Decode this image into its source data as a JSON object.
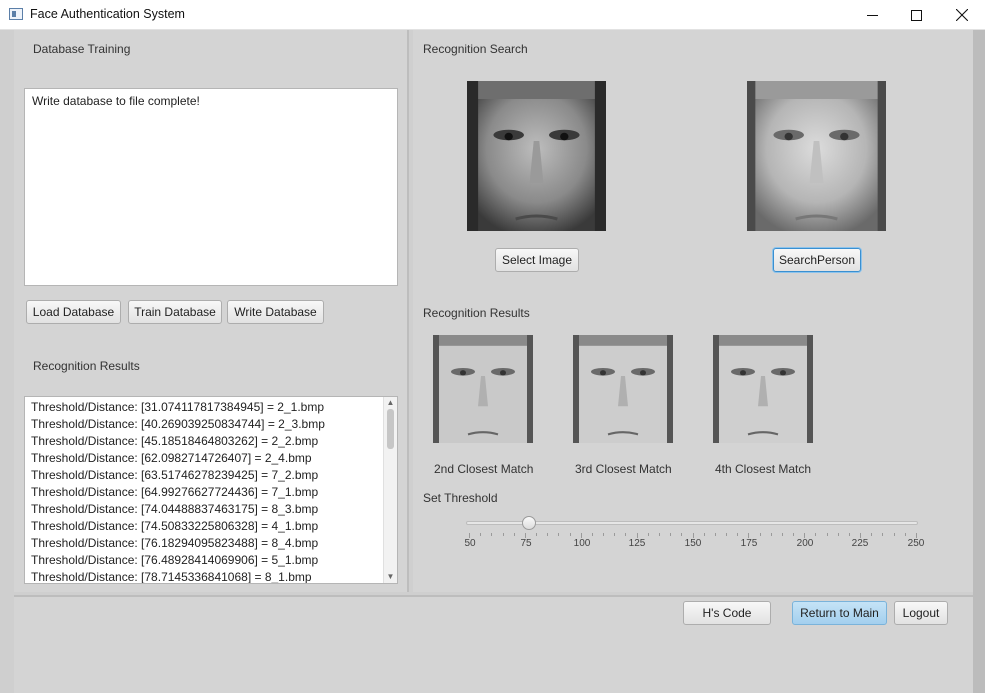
{
  "window": {
    "title": "Face Authentication System"
  },
  "training": {
    "section_label": "Database Training",
    "status_text": "Write database to file complete!",
    "load_label": "Load Database",
    "train_label": "Train Database",
    "write_label": "Write Database"
  },
  "left_results": {
    "section_label": "Recognition Results",
    "rows": [
      "Threshold/Distance: [31.074117817384945] = 2_1.bmp",
      "Threshold/Distance: [40.269039250834744] = 2_3.bmp",
      "Threshold/Distance: [45.18518464803262] = 2_2.bmp",
      "Threshold/Distance: [62.0982714726407] = 2_4.bmp",
      "Threshold/Distance: [63.51746278239425] = 7_2.bmp",
      "Threshold/Distance: [64.99276627724436] = 7_1.bmp",
      "Threshold/Distance: [74.04488837463175] = 8_3.bmp",
      "Threshold/Distance: [74.50833225806328] = 4_1.bmp",
      "Threshold/Distance: [76.18294095823488] = 8_4.bmp",
      "Threshold/Distance: [76.48928414069906] = 5_1.bmp",
      "Threshold/Distance: [78.7145336841068] = 8_1.bmp"
    ]
  },
  "search": {
    "section_label": "Recognition Search",
    "select_label": "Select Image",
    "search_label": "SearchPerson"
  },
  "right_results": {
    "section_label": "Recognition Results",
    "matches": [
      "2nd Closest Match",
      "3rd Closest Match",
      "4th Closest Match"
    ]
  },
  "threshold": {
    "section_label": "Set Threshold",
    "value": 77,
    "min": 50,
    "max": 250,
    "tick_labels": [
      "50",
      "75",
      "100",
      "125",
      "150",
      "175",
      "200",
      "225",
      "250"
    ]
  },
  "footer": {
    "code_label": "H's Code",
    "return_label": "Return to Main",
    "logout_label": "Logout"
  }
}
